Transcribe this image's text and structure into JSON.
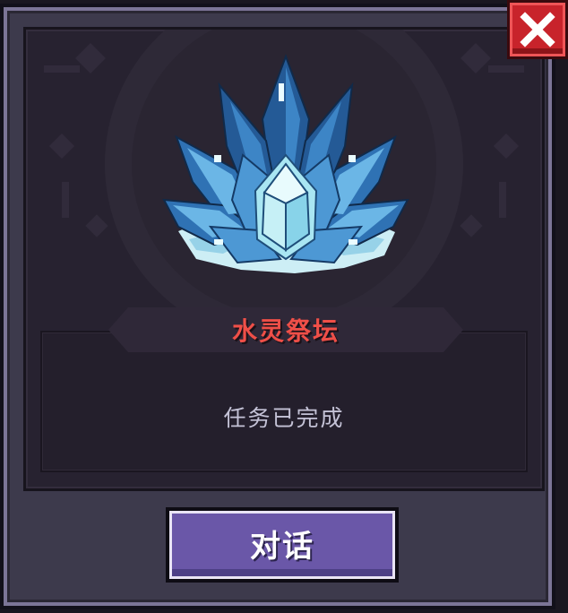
{
  "shrine": {
    "name": "水灵祭坛",
    "status": "任务已完成",
    "image_icon": "water-crystal-shrine"
  },
  "actions": {
    "talk_label": "对话",
    "close_icon": "close-x-icon"
  },
  "colors": {
    "frame": "#3d3a4c",
    "panel": "#272230",
    "name_text": "#ef4f48",
    "status_text": "#c4c2d6",
    "talk_button": "#6a57a8",
    "close_button": "#c8232b",
    "crystal_light": "#d8f6fb",
    "crystal_mid": "#5ea8dc",
    "crystal_dark": "#245a96"
  }
}
